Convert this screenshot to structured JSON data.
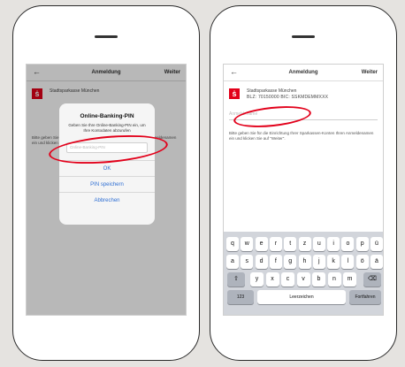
{
  "left": {
    "nav": {
      "back": "←",
      "title": "Anmeldung",
      "next": "Weiter"
    },
    "bank_name": "Stadtsparkasse München",
    "hint": "Bitte geben Sie für die Einrichtung Ihrer Sparkassen-Konten Ihren Anmeldenamen ein und klicken Sie auf \"Weiter\".",
    "dialog": {
      "title": "Online-Banking-PIN",
      "message": "Geben Sie Ihre Online-Banking-PIN ein, um Ihre Kontodaten abzurufen",
      "placeholder": "Online-Banking-PIN",
      "ok": "OK",
      "save": "PIN speichern",
      "cancel": "Abbrechen"
    }
  },
  "right": {
    "nav": {
      "back": "←",
      "title": "Anmeldung",
      "next": "Weiter"
    },
    "bank_name": "Stadtsparkasse München",
    "bank_bic": "BLZ: 70150000  BIC: SSKMDEMMXXX",
    "username_placeholder": "Anmeldename",
    "hint": "Bitte geben Sie für die Einrichtung Ihrer Sparkassen-Konten Ihren Anmeldenamen ein und klicken Sie auf \"Weiter\".",
    "keyboard": {
      "row1": [
        "q",
        "w",
        "e",
        "r",
        "t",
        "z",
        "u",
        "i",
        "o",
        "p",
        "ü"
      ],
      "row2": [
        "a",
        "s",
        "d",
        "f",
        "g",
        "h",
        "j",
        "k",
        "l",
        "ö",
        "ä"
      ],
      "row3": [
        "y",
        "x",
        "c",
        "v",
        "b",
        "n",
        "m"
      ],
      "shift": "⇧",
      "backspace": "⌫",
      "numbers": "123",
      "space": "Leerzeichen",
      "return": "Fortfahren"
    }
  },
  "colors": {
    "accent": "#e2001a",
    "link": "#2f6fd3"
  }
}
